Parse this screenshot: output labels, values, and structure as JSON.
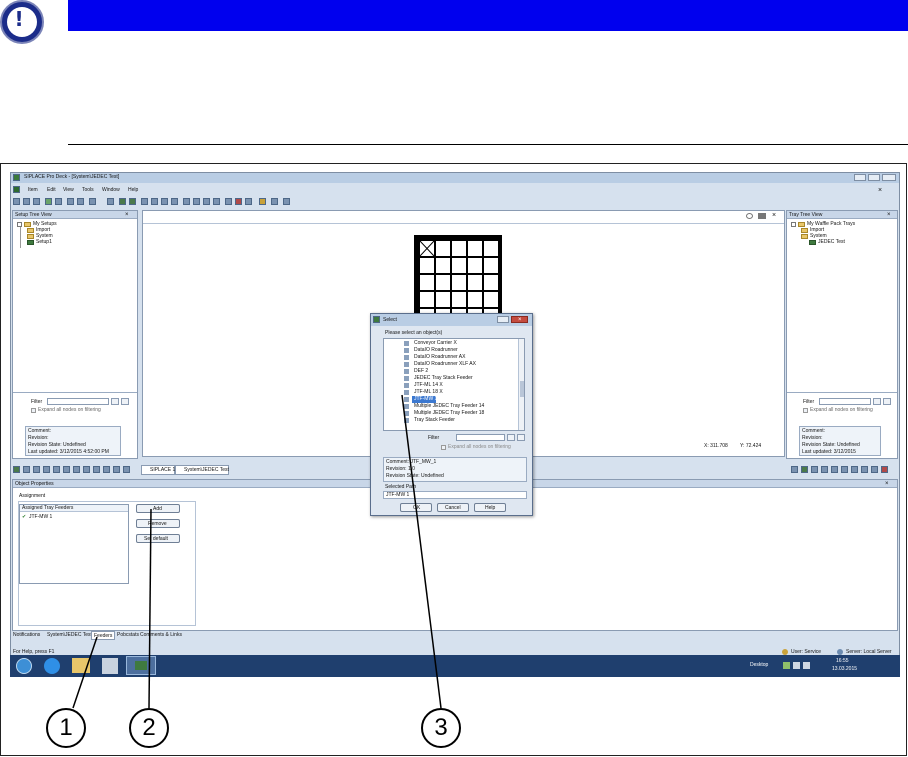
{
  "app": {
    "title": "SIPLACE Pro Deck - [System\\JEDEC Test]",
    "menu": [
      "Item",
      "Edit",
      "View",
      "Tools",
      "Window",
      "Help"
    ]
  },
  "setup_tree": {
    "title": "Setup Tree View",
    "items": [
      "My Setups",
      "Import",
      "System",
      "Setup1"
    ],
    "filter_label": "Filter",
    "expand_label": "Expand all nodes on filtering",
    "info": [
      "Comment:",
      "Revision:",
      "Revision State: Undefined",
      "Last updated: 3/12/2015 4:52:00 PM"
    ]
  },
  "tray_tree": {
    "title": "Tray Tree View",
    "items": [
      "My Waffle Pack Trays",
      "Import",
      "System",
      "JEDEC Test"
    ],
    "filter_label": "Filter",
    "expand_label": "Expand all nodes on filtering",
    "info": [
      "Comment:",
      "Revision:",
      "Revision State: Undefined",
      "Last updated: 3/12/2015"
    ]
  },
  "coords": {
    "x": "X: 311.708",
    "y": "Y: 72.424"
  },
  "doc_tabs": [
    "SIPLACE 1",
    "System\\JEDEC Test"
  ],
  "object_properties": {
    "title": "Object Properties",
    "group_label": "Assignment",
    "list_header": "Assigned Tray Feeders",
    "list_items": [
      "JTF-MW 1"
    ],
    "buttons": {
      "add": "Add",
      "remove": "Remove",
      "set_default": "Set default"
    }
  },
  "bottom_tabs": [
    "Notifications",
    "System\\JEDEC Test",
    "Feeders",
    "Pobcstats",
    "Comments & Links"
  ],
  "status": {
    "left": "For Help, press F1",
    "user": "User: Service",
    "server": "Server: Local Server"
  },
  "taskbar": {
    "desktop": "Desktop",
    "time": "16:55",
    "date": "13.03.2015"
  },
  "dialog": {
    "title": "Select",
    "prompt": "Please select an object(s)",
    "items": [
      "Conveyor Carrier X",
      "DataIO Roadrunner",
      "DataIO Roadrunner AX",
      "DataIO Roadrunner XLF AX",
      "DEF 2",
      "JEDEC Tray Stack Feeder",
      "JTF-ML 14 X",
      "JTF-ML 18 X",
      "JTF-MW 1",
      "Multiple JEDEC Tray Feeder 14",
      "Multiple JEDEC Tray Feeder 18",
      "Tray Stack Feeder"
    ],
    "selected_index": 8,
    "filter_label": "Filter",
    "expand_label": "Expand all nodes on filtering",
    "info": [
      "Comment: JTF_MW_1",
      "Revision: 1.0",
      "Revision State: Undefined"
    ],
    "selected_path_label": "Selected Path",
    "selected_path": "JTF-MW 1",
    "buttons": {
      "ok": "OK",
      "cancel": "Cancel",
      "help": "Help"
    }
  },
  "callouts": [
    "1",
    "2",
    "3"
  ],
  "colors": {
    "notice_bar": "#0000ee",
    "window_bg": "#d6e1ee",
    "taskbar": "#1f3f6e"
  }
}
